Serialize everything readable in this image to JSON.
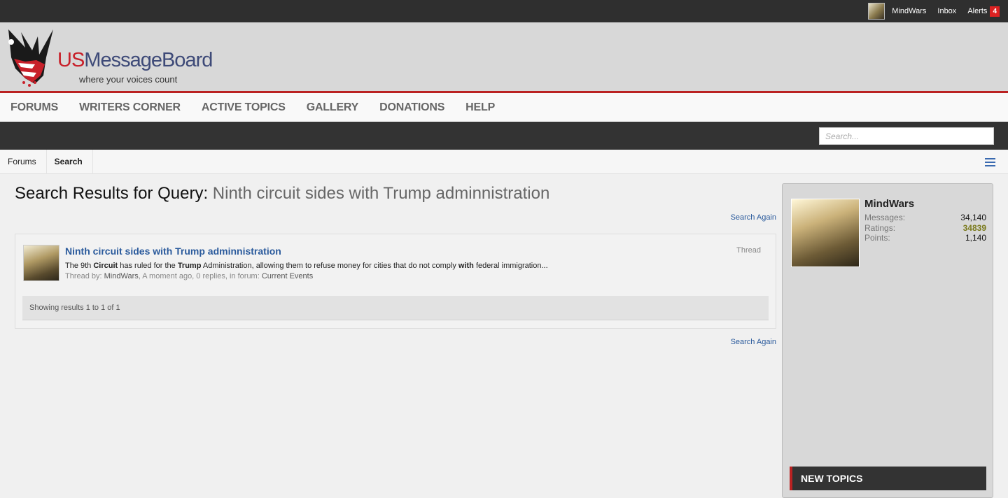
{
  "topbar": {
    "username": "MindWars",
    "inbox": "Inbox",
    "alerts_label": "Alerts",
    "alerts_count": "4"
  },
  "logo": {
    "us": "US",
    "messageboard": "MessageBoard",
    "tagline": "where your voices count"
  },
  "nav": {
    "tabs": [
      "FORUMS",
      "WRITERS CORNER",
      "ACTIVE TOPICS",
      "GALLERY",
      "DONATIONS",
      "HELP"
    ]
  },
  "search": {
    "placeholder": "Search..."
  },
  "breadcrumbs": [
    "Forums",
    "Search"
  ],
  "page": {
    "title_prefix": "Search Results for Query:",
    "query": "Ninth circuit sides with Trump adminnistration",
    "search_again": "Search Again"
  },
  "results": [
    {
      "title": "Ninth circuit sides with Trump adminnistration",
      "type": "Thread",
      "snippet": {
        "p1": "The 9th ",
        "b1": "Circuit",
        "p2": " has ruled for the ",
        "b2": "Trump",
        "p3": " Administration, allowing them to refuse money for cities that do not comply ",
        "b3": "with",
        "p4": " federal immigration..."
      },
      "meta_prefix": "Thread by: ",
      "author": "MindWars",
      "meta_mid": ", A moment ago, 0 replies, in forum: ",
      "forum": "Current Events"
    }
  ],
  "pagination": {
    "showing": "Showing results 1 to 1 of 1"
  },
  "sidebar": {
    "username": "MindWars",
    "stats": [
      {
        "label": "Messages:",
        "value": "34,140",
        "color": "#111111"
      },
      {
        "label": "Ratings:",
        "value": "34839",
        "color": "#7a7a1c"
      },
      {
        "label": "Points:",
        "value": "1,140",
        "color": "#111111"
      }
    ],
    "new_topics": "NEW TOPICS"
  }
}
